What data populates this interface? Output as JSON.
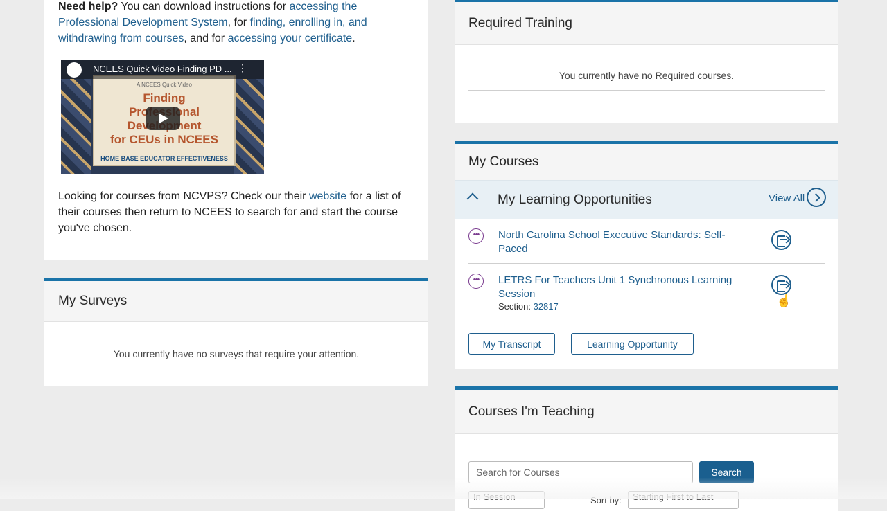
{
  "help": {
    "bold": "Need help?",
    "t1": " You can download instructions for ",
    "link1": "accessing the Professional Development System",
    "t2": ", for ",
    "link2": "finding, enrolling in, and withdrawing from courses",
    "t3": ", and for ",
    "link3": "accessing your certificate",
    "t4": "."
  },
  "video": {
    "title": "NCEES Quick Video Finding PD ...",
    "subtitle": "A NCEES Quick Video",
    "lines": [
      "Finding",
      "Professional",
      "Development",
      "for CEUs in NCEES"
    ],
    "brand": "HOME BASE EDUCATOR EFFECTIVENESS"
  },
  "ncvps": {
    "t1": "Looking for courses from NCVPS? Check our their ",
    "link": "website",
    "t2": " for a list of their courses then return to NCEES to search for and start the course you've chosen."
  },
  "surveys": {
    "title": "My Surveys",
    "empty": "You currently have no surveys that require your attention."
  },
  "required": {
    "title": "Required Training",
    "empty": "You currently have no Required courses."
  },
  "courses": {
    "title": "My Courses",
    "section_title": "My Learning Opportunities",
    "view_all": "View All",
    "items": [
      {
        "title": "North Carolina School Executive Standards: Self-Paced"
      },
      {
        "title": "LETRS For Teachers Unit 1 Synchronous Learning Session",
        "section_label": "Section: ",
        "section_value": "32817"
      }
    ],
    "transcript_btn": "My Transcript",
    "lo_btn": "Learning Opportunity"
  },
  "teaching": {
    "title": "Courses I'm Teaching",
    "search_placeholder": "Search for Courses",
    "search_btn": "Search",
    "filter_value": "In Session",
    "sort_label": "Sort by:",
    "sort_value": "Starting First to Last"
  }
}
